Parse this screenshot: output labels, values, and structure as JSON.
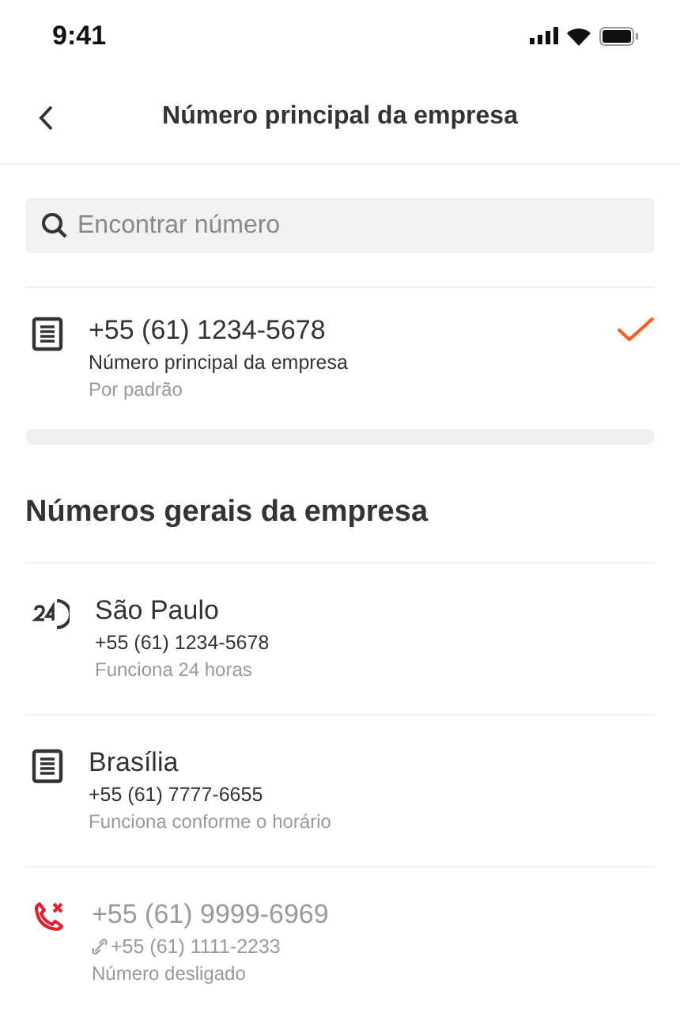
{
  "status_bar": {
    "time": "9:41"
  },
  "nav": {
    "title": "Número principal da empresa"
  },
  "search": {
    "placeholder": "Encontrar número"
  },
  "main_number": {
    "kind": "document",
    "title": "+55 (61) 1234-5678",
    "subtitle": "Número principal da empresa",
    "note": "Por padrão",
    "selected": true
  },
  "section": {
    "title": "Números gerais da empresa"
  },
  "items": [
    {
      "kind": "allday",
      "title": "São Paulo",
      "number": "+55 (61) 1234-5678",
      "linked": false,
      "note": "Funciona 24 horas",
      "disabled": false
    },
    {
      "kind": "document",
      "title": "Brasília",
      "number": "+55 (61) 7777-6655",
      "linked": false,
      "note": "Funciona conforme o horário",
      "disabled": false
    },
    {
      "kind": "disconnected",
      "title": "+55 (61) 9999-6969",
      "number": "+55 (61) 1111-2233",
      "linked": true,
      "note": "Número desligado",
      "disabled": true
    }
  ]
}
